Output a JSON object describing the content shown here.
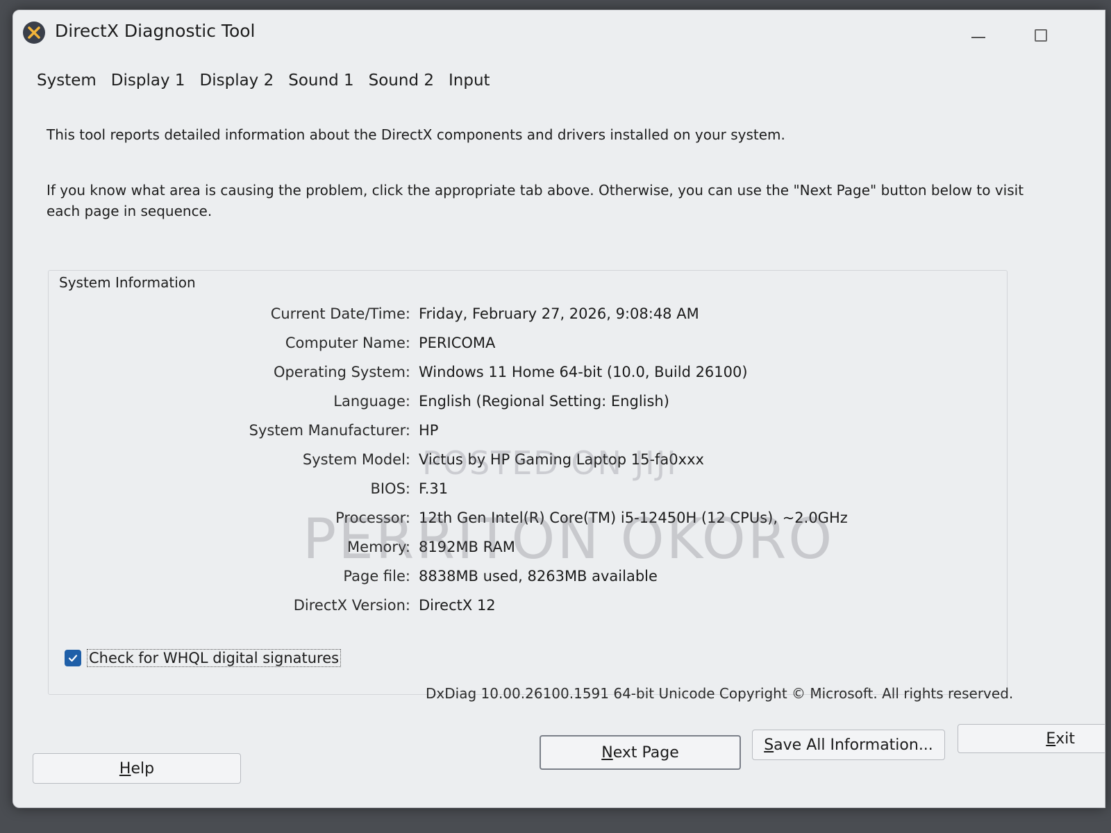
{
  "window": {
    "title": "DirectX Diagnostic Tool",
    "icon": "directx-x-icon"
  },
  "tabs": [
    {
      "label": "System"
    },
    {
      "label": "Display 1"
    },
    {
      "label": "Display 2"
    },
    {
      "label": "Sound 1"
    },
    {
      "label": "Sound 2"
    },
    {
      "label": "Input"
    }
  ],
  "intro": {
    "line1": "This tool reports detailed information about the DirectX components and drivers installed on your system.",
    "line2": "If you know what area is causing the problem, click the appropriate tab above.  Otherwise, you can use the \"Next Page\" button below to visit each page in sequence."
  },
  "system_info": {
    "group_label": "System Information",
    "rows": [
      {
        "label": "Current Date/Time:",
        "value": "Friday, February 27, 2026, 9:08:48 AM"
      },
      {
        "label": "Computer Name:",
        "value": "PERICOMA"
      },
      {
        "label": "Operating System:",
        "value": "Windows 11 Home 64-bit (10.0, Build 26100)"
      },
      {
        "label": "Language:",
        "value": "English (Regional Setting: English)"
      },
      {
        "label": "System Manufacturer:",
        "value": "HP"
      },
      {
        "label": "System Model:",
        "value": "Victus by HP Gaming Laptop 15-fa0xxx"
      },
      {
        "label": "BIOS:",
        "value": "F.31"
      },
      {
        "label": "Processor:",
        "value": "12th Gen Intel(R) Core(TM) i5-12450H (12 CPUs), ~2.0GHz"
      },
      {
        "label": "Memory:",
        "value": "8192MB RAM"
      },
      {
        "label": "Page file:",
        "value": "8838MB used, 8263MB available"
      },
      {
        "label": "DirectX Version:",
        "value": "DirectX 12"
      }
    ]
  },
  "whql": {
    "label": "Check for WHQL digital signatures",
    "checked": true
  },
  "footer": {
    "version_text": "DxDiag 10.00.26100.1591 64-bit Unicode  Copyright © Microsoft. All rights reserved."
  },
  "buttons": {
    "help": {
      "first": "H",
      "rest": "elp"
    },
    "next_page": {
      "first": "N",
      "rest": "ext Page"
    },
    "save_all": {
      "first": "S",
      "rest": "ave All Information..."
    },
    "exit": {
      "first": "E",
      "rest": "xit"
    }
  },
  "watermarks": {
    "line1": "POSTED ON JIJI",
    "line2": "PERRITON OKORO"
  },
  "colors": {
    "window_bg": "#eceef0",
    "checkbox_accent": "#1f5fa8"
  }
}
